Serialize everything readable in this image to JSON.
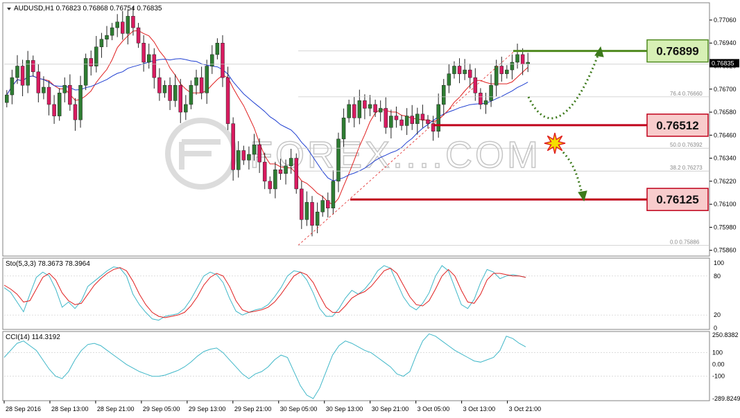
{
  "symbol_header": "AUDUSD,H1  0.76823 0.76868 0.76754 0.76835",
  "stoch_header": "Sto(5,3,3) 78.3673 78.3964",
  "cci_header": "CCI(14) 114.3192",
  "watermark": "FOREX....COM",
  "colors": {
    "bull": "#2e7d32",
    "bear": "#d81b60",
    "ma_fast": "#e02020",
    "ma_slow": "#1f3fd1",
    "stoch_main": "#3fb7c8",
    "stoch_signal": "#e02020",
    "cci": "#3fb7c8",
    "resistance": "#4f8a1f",
    "support": "#c0001a"
  },
  "chart_data": {
    "type": "candlestick",
    "price_axis": {
      "ticks": [
        "0.77060",
        "0.76940",
        "0.76820",
        "0.76700",
        "0.76580",
        "0.76460",
        "0.76340",
        "0.76220",
        "0.76100",
        "0.75980",
        "0.75860"
      ],
      "current": "0.76835",
      "ylim": [
        0.7583,
        0.7715
      ]
    },
    "time_labels": [
      "28 Sep 2016",
      "28 Sep 13:00",
      "28 Sep 21:00",
      "29 Sep 05:00",
      "29 Sep 13:00",
      "29 Sep 21:00",
      "30 Sep 05:00",
      "30 Sep 13:00",
      "30 Sep 21:00",
      "3 Oct 05:00",
      "3 Oct 13:00",
      "3 Oct 21:00"
    ],
    "candles_close": [
      0.7667,
      0.7676,
      0.7682,
      0.7672,
      0.7685,
      0.7679,
      0.7668,
      0.7671,
      0.7662,
      0.7656,
      0.7668,
      0.7672,
      0.7662,
      0.7654,
      0.7672,
      0.7686,
      0.7682,
      0.7692,
      0.7696,
      0.7698,
      0.7702,
      0.7705,
      0.7699,
      0.7708,
      0.7702,
      0.7694,
      0.7684,
      0.7688,
      0.7676,
      0.7668,
      0.7672,
      0.7664,
      0.7672,
      0.7658,
      0.7662,
      0.7672,
      0.7676,
      0.7668,
      0.7682,
      0.7688,
      0.7694,
      0.7676,
      0.7652,
      0.7628,
      0.7638,
      0.7633,
      0.7636,
      0.7641,
      0.7632,
      0.7622,
      0.7618,
      0.7628,
      0.7626,
      0.763,
      0.7634,
      0.7618,
      0.7602,
      0.7611,
      0.7599,
      0.7606,
      0.7612,
      0.7608,
      0.7622,
      0.7644,
      0.7655,
      0.7662,
      0.7655,
      0.7664,
      0.766,
      0.7662,
      0.7658,
      0.766,
      0.765,
      0.7656,
      0.7654,
      0.7651,
      0.7656,
      0.7652,
      0.7657,
      0.7654,
      0.7652,
      0.7648,
      0.7662,
      0.7672,
      0.7678,
      0.7682,
      0.7678,
      0.768,
      0.7676,
      0.7668,
      0.7662,
      0.7664,
      0.7672,
      0.7682,
      0.7678,
      0.768,
      0.7684,
      0.7688,
      0.7683,
      0.7684
    ],
    "fibonacci": [
      {
        "label": "76.4",
        "value": "0.76660"
      },
      {
        "label": "50.0",
        "value": "0.76392"
      },
      {
        "label": "38.2",
        "value": "0.76273"
      },
      {
        "label": "0.0",
        "value": "0.75886"
      }
    ],
    "levels": [
      {
        "name": "resistance",
        "value": 0.76899,
        "label": "0.76899"
      },
      {
        "name": "pivot",
        "value": 0.76512,
        "label": "0.76512"
      },
      {
        "name": "support",
        "value": 0.76125,
        "label": "0.76125"
      }
    ],
    "stochastic": {
      "axis_labels": [
        "100",
        "80",
        "20",
        "0"
      ],
      "main": [
        62,
        55,
        40,
        25,
        52,
        78,
        86,
        80,
        60,
        32,
        40,
        30,
        42,
        64,
        72,
        80,
        88,
        94,
        92,
        80,
        52,
        36,
        24,
        14,
        12,
        18,
        20,
        22,
        30,
        44,
        62,
        80,
        86,
        82,
        70,
        46,
        26,
        20,
        24,
        28,
        30,
        36,
        48,
        62,
        80,
        88,
        86,
        74,
        54,
        30,
        18,
        18,
        30,
        46,
        58,
        52,
        60,
        72,
        88,
        96,
        92,
        70,
        48,
        34,
        28,
        38,
        54,
        80,
        96,
        88,
        62,
        36,
        30,
        44,
        70,
        90,
        86,
        76,
        80,
        82,
        80,
        78
      ],
      "signal": [
        66,
        60,
        52,
        40,
        42,
        60,
        78,
        84,
        74,
        54,
        42,
        36,
        38,
        52,
        66,
        76,
        84,
        90,
        93,
        88,
        72,
        52,
        36,
        24,
        18,
        16,
        18,
        20,
        24,
        34,
        48,
        66,
        78,
        84,
        80,
        64,
        42,
        28,
        24,
        26,
        28,
        32,
        40,
        52,
        66,
        80,
        86,
        82,
        70,
        50,
        32,
        24,
        24,
        34,
        46,
        52,
        56,
        64,
        76,
        88,
        92,
        84,
        66,
        48,
        36,
        34,
        42,
        60,
        80,
        90,
        80,
        58,
        40,
        38,
        52,
        74,
        84,
        84,
        82,
        80,
        80,
        78
      ]
    },
    "cci": {
      "axis_labels": [
        "250.8382",
        "100",
        "0.00",
        "-100",
        "-289.8249"
      ],
      "values": [
        60,
        120,
        180,
        200,
        160,
        120,
        40,
        -40,
        -100,
        -120,
        -60,
        40,
        120,
        170,
        180,
        160,
        120,
        80,
        40,
        0,
        -30,
        -60,
        -80,
        -100,
        -100,
        -90,
        -70,
        -50,
        -20,
        20,
        70,
        110,
        130,
        140,
        100,
        40,
        -20,
        -80,
        -120,
        -80,
        -60,
        -20,
        40,
        80,
        60,
        -60,
        -180,
        -260,
        -290,
        -200,
        -60,
        80,
        160,
        200,
        180,
        150,
        120,
        100,
        60,
        20,
        -20,
        -80,
        -100,
        -60,
        80,
        200,
        260,
        240,
        200,
        160,
        120,
        90,
        60,
        30,
        20,
        40,
        60,
        120,
        240,
        220,
        180,
        150
      ]
    }
  }
}
